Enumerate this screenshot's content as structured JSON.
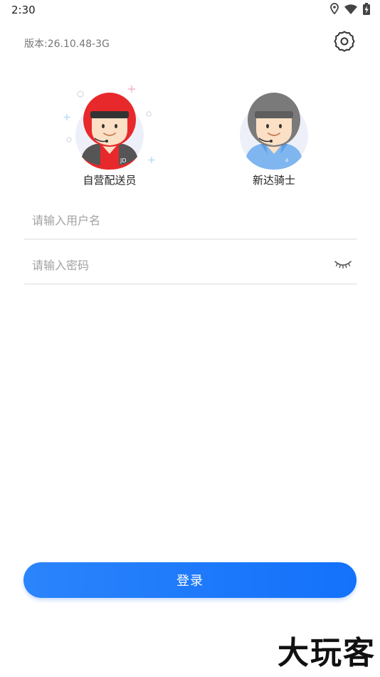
{
  "status_bar": {
    "time": "2:30",
    "icons": [
      "location-icon",
      "wifi-icon",
      "battery-charging-icon"
    ]
  },
  "header": {
    "version": "版本:26.10.48-3G",
    "settings_icon": "gear-icon"
  },
  "roles": [
    {
      "label": "自营配送员",
      "helmet_color": "#e8292b",
      "shirt_color": "#e8292b"
    },
    {
      "label": "新达骑士",
      "helmet_color": "#7a7a7a",
      "shirt_color": "#7fb6ef"
    }
  ],
  "form": {
    "username_placeholder": "请输入用户名",
    "password_placeholder": "请输入密码",
    "toggle_icon": "eye-closed-icon"
  },
  "login": {
    "label": "登录"
  },
  "watermark": "大玩客",
  "colors": {
    "primary": "#1677ff",
    "divider": "#dcdcdc"
  }
}
